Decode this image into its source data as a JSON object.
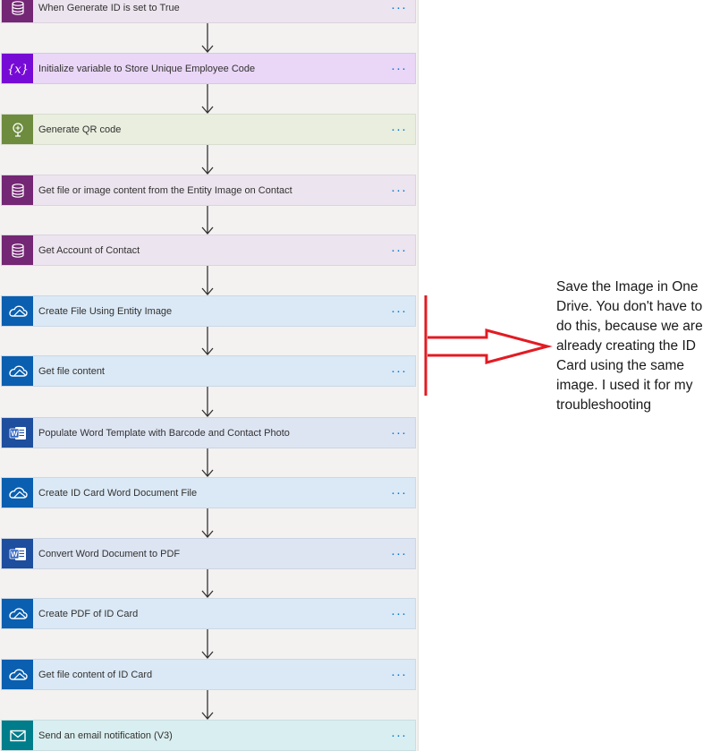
{
  "steps": [
    {
      "label": "When Generate ID is set to True",
      "icon": "dataverse-icon",
      "iconBg": "#742774",
      "bg": "#ece4ef"
    },
    {
      "label": "Initialize variable to Store Unique Employee Code",
      "icon": "variable-icon",
      "iconBg": "#770bd6",
      "bg": "#ead7f7"
    },
    {
      "label": "Generate QR code",
      "icon": "qr-service-icon",
      "iconBg": "#6d8c3e",
      "bg": "#e9eedf"
    },
    {
      "label": "Get file or image content from the Entity Image on Contact",
      "icon": "dataverse-icon",
      "iconBg": "#742774",
      "bg": "#ece4ef"
    },
    {
      "label": "Get Account of Contact",
      "icon": "dataverse-icon",
      "iconBg": "#742774",
      "bg": "#ece4ef"
    },
    {
      "label": "Create File Using Entity Image",
      "icon": "onedrive-icon",
      "iconBg": "#0a5fb0",
      "bg": "#dbe9f6"
    },
    {
      "label": "Get file content",
      "icon": "onedrive-icon",
      "iconBg": "#0a5fb0",
      "bg": "#dbe9f6"
    },
    {
      "label": "Populate Word Template with Barcode and Contact Photo",
      "icon": "word-icon",
      "iconBg": "#1e4e9e",
      "bg": "#dde5f3"
    },
    {
      "label": "Create ID Card Word Document File",
      "icon": "onedrive-icon",
      "iconBg": "#0a5fb0",
      "bg": "#dbe9f6"
    },
    {
      "label": "Convert Word Document to PDF",
      "icon": "word-icon",
      "iconBg": "#1e4e9e",
      "bg": "#dde5f3"
    },
    {
      "label": "Create PDF of ID Card",
      "icon": "onedrive-icon",
      "iconBg": "#0a5fb0",
      "bg": "#dbe9f6"
    },
    {
      "label": "Get file content of ID Card",
      "icon": "onedrive-icon",
      "iconBg": "#0a5fb0",
      "bg": "#dbe9f6"
    },
    {
      "label": "Send an email notification (V3)",
      "icon": "mail-icon",
      "iconBg": "#007d8a",
      "bg": "#d9eef0"
    }
  ],
  "more_label": "···",
  "annotation": {
    "text": "Save the Image in One Drive. You don't have to do this,  because we are already creating the ID Card using the same image. I used it for my troubleshooting",
    "color": "#e21b23"
  }
}
